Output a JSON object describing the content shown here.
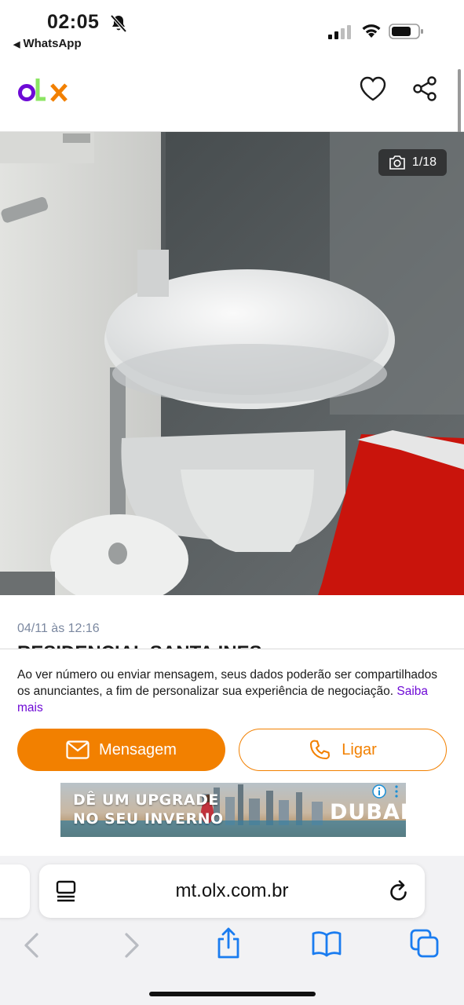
{
  "status_bar": {
    "time": "02:05",
    "back_app": "WhatsApp"
  },
  "header": {
    "logo_letters": [
      "o",
      "l",
      "x"
    ],
    "logo_colors": [
      "#6e0ad6",
      "#8ce563",
      "#f28000"
    ]
  },
  "gallery": {
    "counter": "1/18"
  },
  "listing": {
    "date": "04/11 às 12:16",
    "title": "RESIDENCIAL SANTA INES"
  },
  "contact": {
    "disclaimer": "Ao ver número ou enviar mensagem, seus dados poderão ser compartilhados os anunciantes, a fim de personalizar sua experiência de negociação.",
    "learn_more": "Saiba mais",
    "message_label": "Mensagem",
    "call_label": "Ligar",
    "accent_color": "#f28000"
  },
  "ad": {
    "line1": "DÊ UM UPGRADE",
    "line2": "NO SEU INVERNO",
    "brand": "DUBAI"
  },
  "browser": {
    "url": "mt.olx.com.br"
  }
}
